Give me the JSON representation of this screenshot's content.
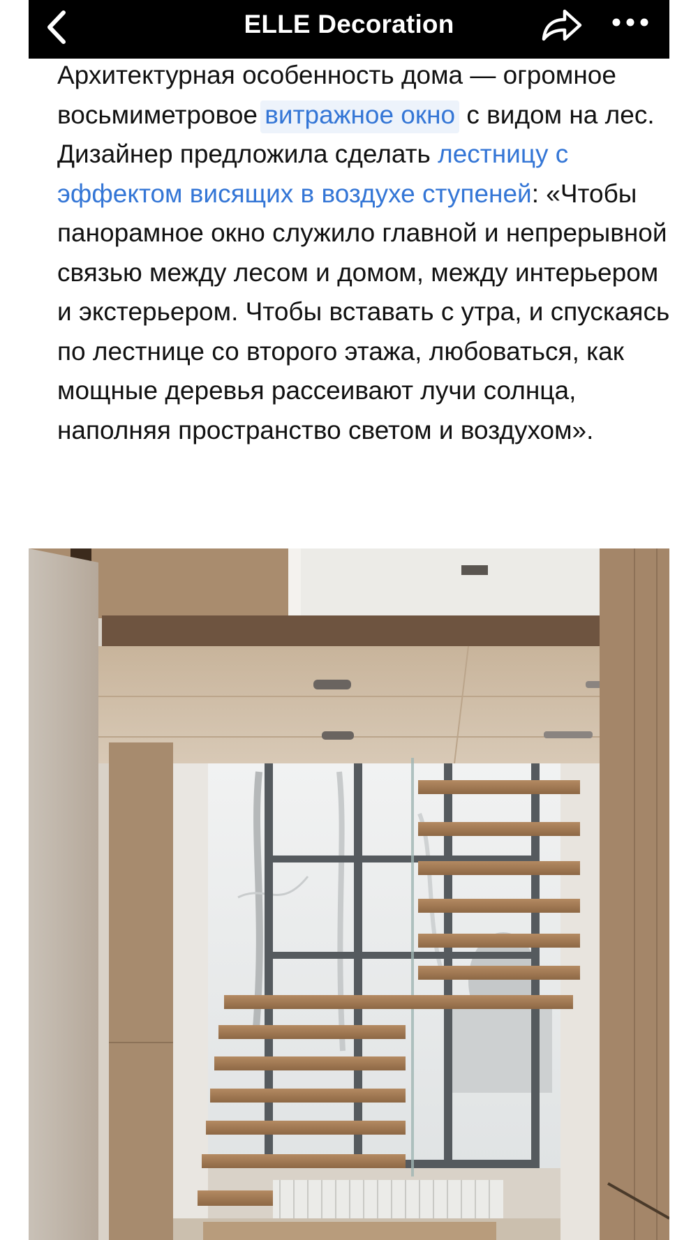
{
  "navbar": {
    "title": "ELLE Decoration",
    "back_icon": "chevron-left-icon",
    "share_icon": "share-arrow-icon",
    "more_icon": "ellipsis-icon"
  },
  "article": {
    "segments": [
      {
        "text": "Архитектурная особенность дома — огромное восьмиметровое ",
        "link": false
      },
      {
        "text": "витражное окно",
        "link": true
      },
      {
        "text": " с видом на лес. Дизайнер предложила сделать ",
        "link": false
      },
      {
        "text": "лестницу с эффектом висящих в воздухе ступеней",
        "link": true
      },
      {
        "text": ": «Чтобы панорамное окно служило главной и непрерывной связью между лесом и домом, между интерьером и экстерьером. Чтобы вставать с утра, и спускаясь по лестнице со второго этажа, любоваться, как мощные деревья рассеивают лучи солнца, наполняя пространство светом и воздухом».",
        "link": false
      }
    ]
  },
  "photo": {
    "subject": "floating-staircase-interior"
  },
  "colors": {
    "navbar_bg": "#000000",
    "link": "#3476d6",
    "text": "#111111",
    "wood": "#a67f5a"
  }
}
